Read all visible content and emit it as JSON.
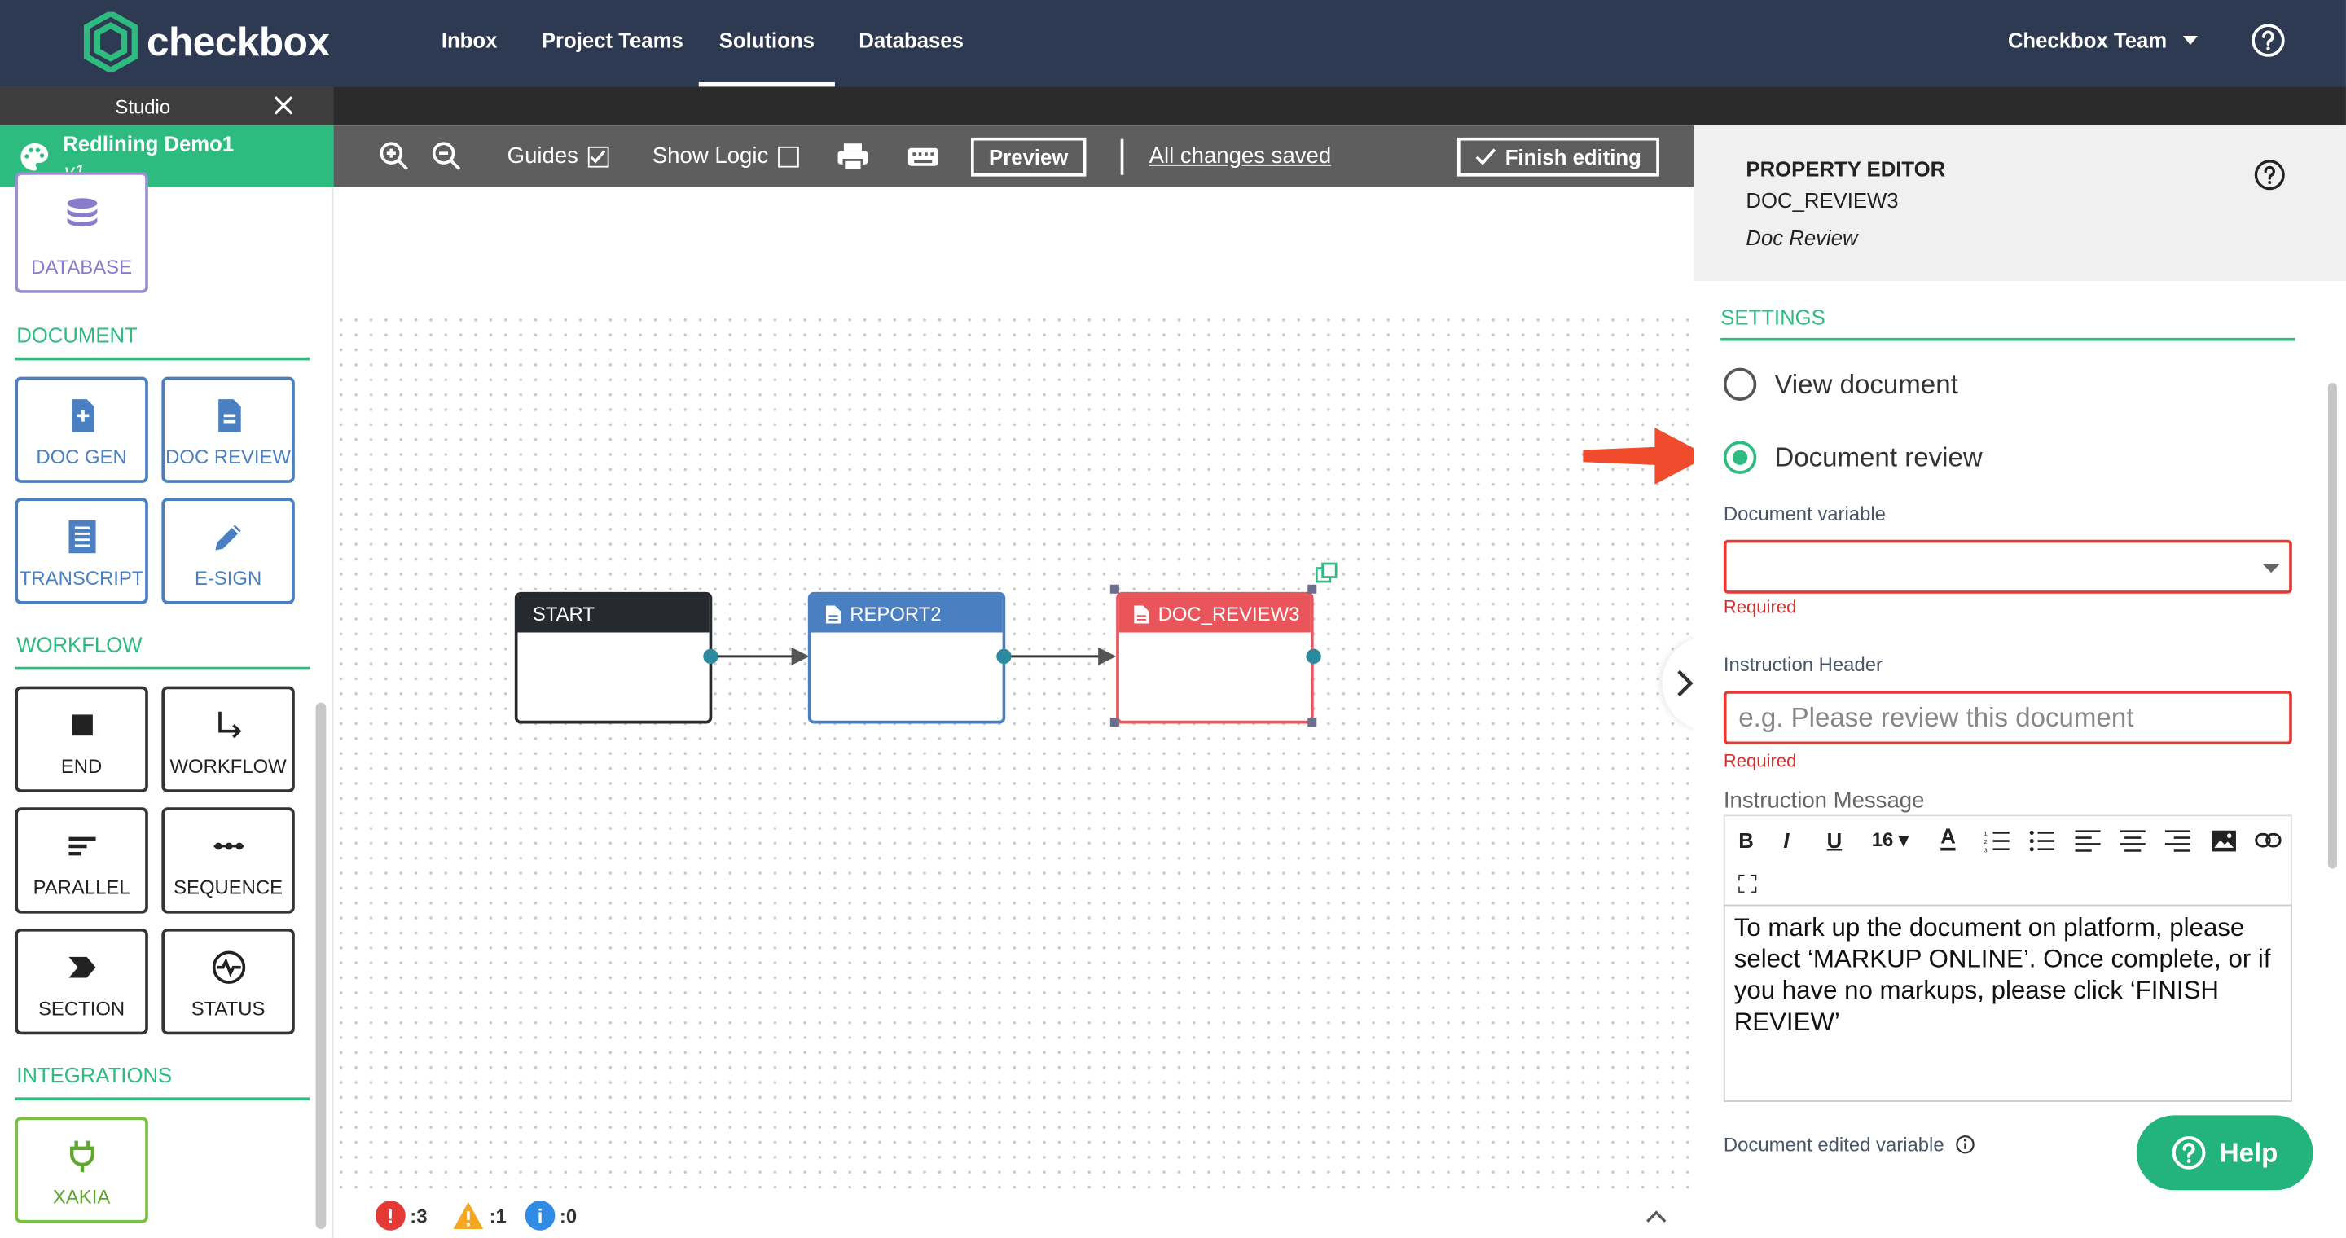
{
  "brand": {
    "name": "checkbox",
    "accent": "#2dbb80",
    "nav_bg": "#2d3a52"
  },
  "nav": {
    "links": [
      "Inbox",
      "Project Teams",
      "Solutions",
      "Databases"
    ],
    "active": "Solutions",
    "team": "Checkbox Team"
  },
  "studio": {
    "tab_label": "Studio"
  },
  "project": {
    "name": "Redlining Demo1",
    "version": "v1"
  },
  "toolbar": {
    "guides_label": "Guides",
    "guides_checked": true,
    "show_logic_label": "Show Logic",
    "show_logic_checked": false,
    "preview_label": "Preview",
    "saved_status": "All changes saved",
    "finish_label": "Finish editing"
  },
  "sidebar": {
    "database_tile": "DATABASE",
    "document_title": "DOCUMENT",
    "document_tiles": [
      "DOC GEN",
      "DOC REVIEW",
      "TRANSCRIPT",
      "E-SIGN"
    ],
    "workflow_title": "WORKFLOW",
    "workflow_tiles": [
      "END",
      "WORKFLOW",
      "PARALLEL",
      "SEQUENCE",
      "SECTION",
      "STATUS"
    ],
    "integrations_title": "INTEGRATIONS",
    "integration_tiles": [
      "XAKIA"
    ]
  },
  "canvas": {
    "nodes": [
      {
        "label": "START",
        "color": "#26292e"
      },
      {
        "label": "REPORT2",
        "color": "#4a7fc1"
      },
      {
        "label": "DOC_REVIEW3",
        "color": "#e9555b"
      }
    ],
    "status": {
      "errors": ":3",
      "warnings": ":1",
      "info": ":0"
    }
  },
  "property_editor": {
    "title": "PROPERTY EDITOR",
    "node_id": "DOC_REVIEW3",
    "node_type": "Doc Review",
    "settings_label": "SETTINGS",
    "options": [
      "View document",
      "Document review"
    ],
    "selected_option": "Document review",
    "document_variable_label": "Document variable",
    "document_variable_value": "",
    "required_text": "Required",
    "instruction_header_label": "Instruction Header",
    "instruction_header_placeholder": "e.g. Please review this document",
    "instruction_message_label": "Instruction Message",
    "font_size": "16",
    "instruction_message": "To mark up the document on platform, please select ‘MARKUP ONLINE’. Once complete, or if you have no markups, please click ‘FINISH REVIEW’",
    "edited_variable_label": "Document edited variable",
    "help_button": "Help"
  }
}
